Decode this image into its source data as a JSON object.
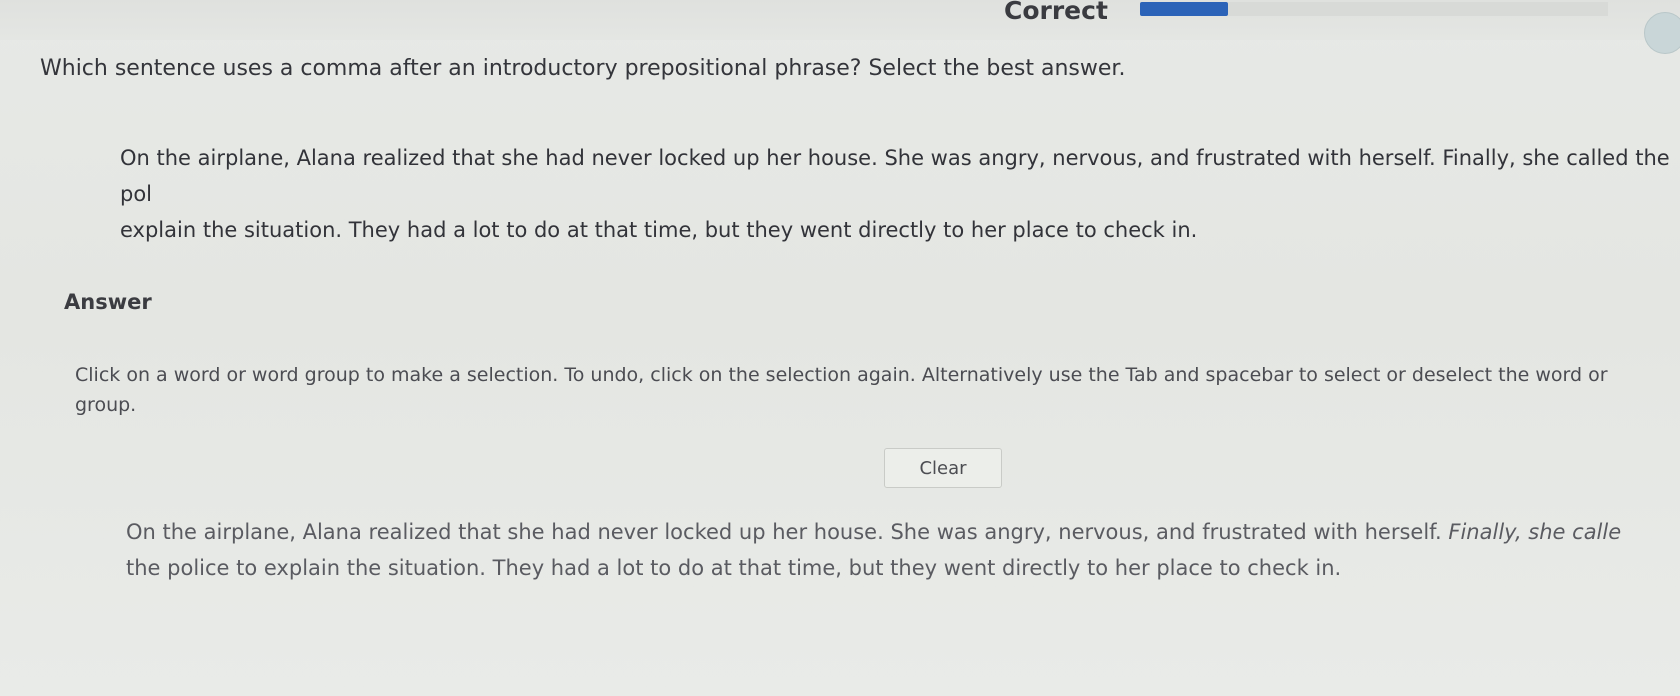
{
  "header": {
    "status": "Correct"
  },
  "question": {
    "prompt": "Which sentence uses a comma after an introductory prepositional phrase? Select the best answer."
  },
  "passage": {
    "line1": "On the airplane, Alana realized that she had never locked up her house. She was angry, nervous, and frustrated with herself. Finally, she called the pol",
    "line2": "explain the situation. They had a lot to do at that time, but they went directly to her place to check in."
  },
  "answer_section": {
    "heading": "Answer",
    "instructions_line1": "Click on a word or word group to make a selection. To undo, click on the selection again. Alternatively use the Tab and spacebar to select or deselect the word or",
    "instructions_line2": "group.",
    "clear_label": "Clear"
  },
  "answer_passage": {
    "sentence1": "On the airplane, Alana realized that she had never locked up her house.",
    "sentence2": "She was angry, nervous, and frustrated with herself.",
    "sentence3_line1": "Finally, she calle",
    "sentence3_line2": "the police to explain the situation.",
    "sentence4": "They had a lot to do at that time, but they went directly to her place to check in."
  },
  "colors": {
    "progress": "#2b63b8",
    "background": "#e5e7e3"
  }
}
